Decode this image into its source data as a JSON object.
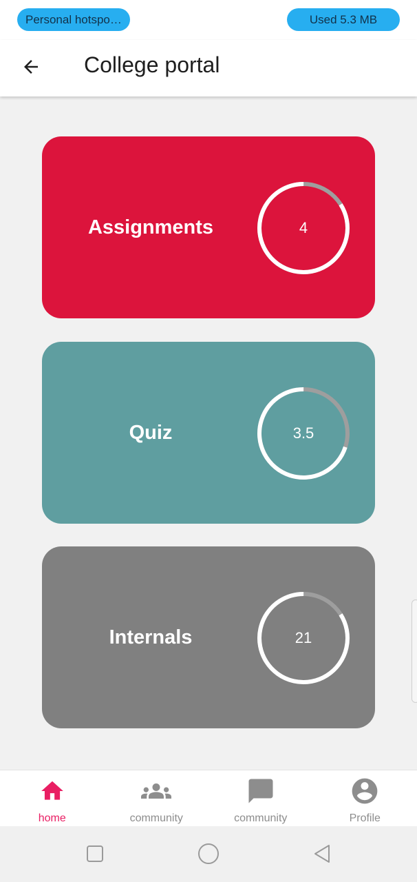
{
  "status_bar": {
    "hotspot_label": "Personal hotspot...",
    "data_usage": "Used  5.3 MB",
    "pill_color": "#27aef0"
  },
  "app_bar": {
    "back_icon": "arrow-left-icon",
    "title": "College portal"
  },
  "cards": [
    {
      "label": "Assignments",
      "value": "4",
      "progress": 0.84,
      "color": "#dc143c"
    },
    {
      "label": "Quiz",
      "value": "3.5",
      "progress": 0.7,
      "color": "#5f9ea0"
    },
    {
      "label": "Internals",
      "value": "21",
      "progress": 0.84,
      "color": "#808080"
    }
  ],
  "bottom_nav": {
    "items": [
      {
        "label": "home",
        "icon": "home-icon",
        "active": true
      },
      {
        "label": "community",
        "icon": "group-icon",
        "active": false
      },
      {
        "label": "community",
        "icon": "chat-icon",
        "active": false
      },
      {
        "label": "Profile",
        "icon": "account-circle-icon",
        "active": false
      }
    ],
    "active_color": "#e91e63",
    "inactive_color": "#8d8d8d"
  },
  "system_nav": {
    "buttons": [
      "recent-apps-icon",
      "home-circle-icon",
      "back-triangle-icon"
    ]
  }
}
